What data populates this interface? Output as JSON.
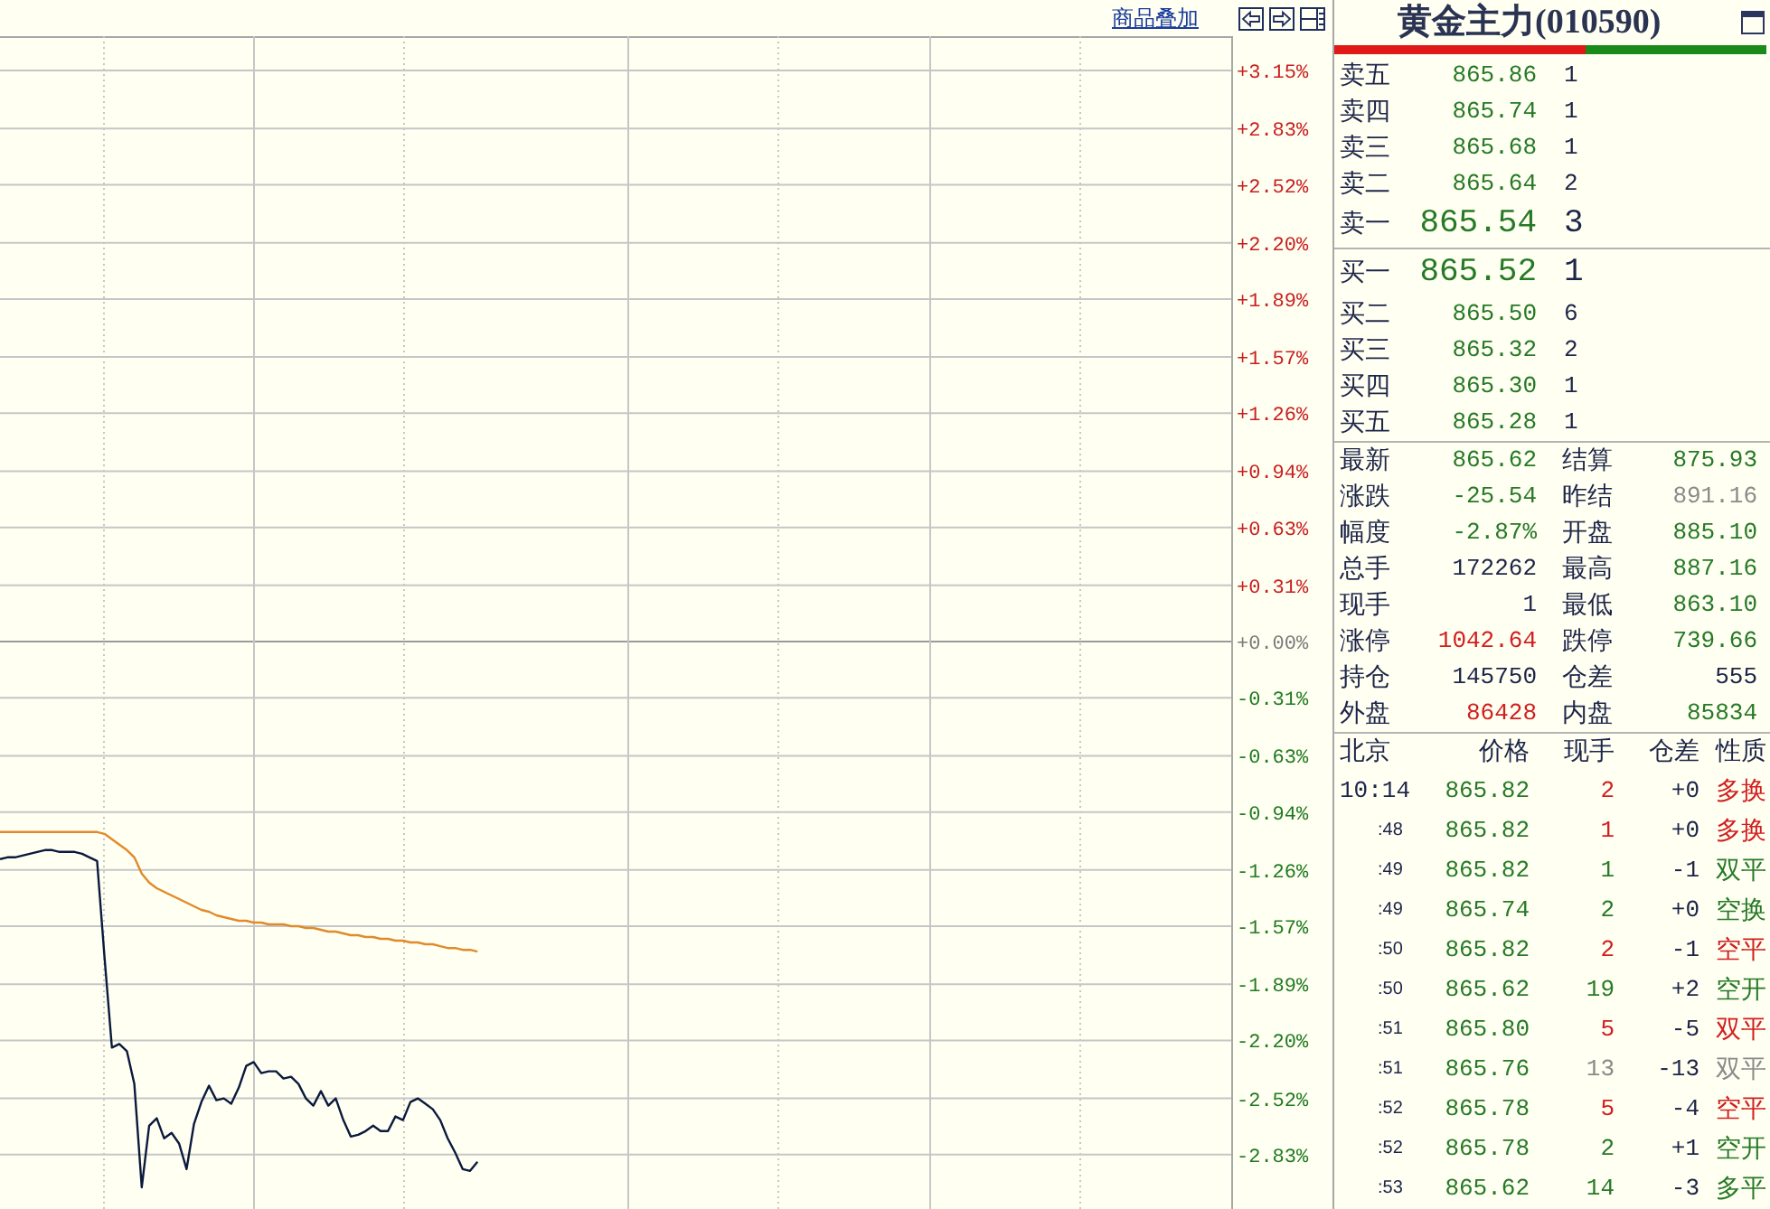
{
  "chart": {
    "overlay_link": "商品叠加",
    "chart_data": {
      "type": "line",
      "grid": true,
      "categories": [
        null,
        null,
        null,
        null,
        null,
        null,
        null,
        null,
        null,
        null,
        null,
        null,
        null,
        null,
        null,
        null,
        null,
        null,
        null,
        null,
        null,
        null,
        null,
        null,
        null,
        null,
        null,
        null,
        null,
        null,
        null,
        null,
        null,
        null,
        null,
        null,
        null,
        null,
        null,
        null,
        null,
        null,
        null,
        null,
        null,
        null,
        null,
        null,
        null,
        null,
        null,
        null,
        null,
        null,
        null,
        null,
        null,
        null,
        null,
        null,
        null,
        null,
        null,
        null,
        null,
        null,
        null,
        null,
        null,
        null,
        null,
        null,
        null,
        null,
        null,
        null,
        null,
        null,
        null,
        null,
        null,
        null,
        null,
        null,
        null,
        null,
        null,
        null,
        null,
        null,
        null,
        null,
        null,
        null,
        null,
        null,
        null,
        null,
        null,
        null,
        null,
        null,
        null,
        null,
        null,
        null,
        null,
        null,
        null,
        null,
        null,
        null,
        null,
        null,
        null,
        null,
        null,
        null,
        null,
        null,
        null,
        null,
        null,
        null,
        null,
        null,
        null,
        null,
        null,
        null,
        null,
        null,
        null,
        null,
        null,
        null,
        null,
        null,
        null,
        null,
        null,
        null,
        null,
        null,
        null,
        null,
        null,
        null,
        null,
        null,
        null,
        null,
        null,
        null,
        null,
        null,
        null,
        null,
        null,
        null,
        null,
        null,
        null,
        null,
        null,
        null
      ],
      "ylim": [
        -3.13,
        3.34
      ],
      "yticks": [
        {
          "value": 3.15,
          "label": "+3.15%"
        },
        {
          "value": 2.83,
          "label": "+2.83%"
        },
        {
          "value": 2.52,
          "label": "+2.52%"
        },
        {
          "value": 2.2,
          "label": "+2.20%"
        },
        {
          "value": 1.89,
          "label": "+1.89%"
        },
        {
          "value": 1.57,
          "label": "+1.57%"
        },
        {
          "value": 1.26,
          "label": "+1.26%"
        },
        {
          "value": 0.94,
          "label": "+0.94%"
        },
        {
          "value": 0.63,
          "label": "+0.63%"
        },
        {
          "value": 0.31,
          "label": "+0.31%"
        },
        {
          "value": 0,
          "label": "+0.00%"
        },
        {
          "value": -0.31,
          "label": "-0.31%"
        },
        {
          "value": -0.63,
          "label": "-0.63%"
        },
        {
          "value": -0.94,
          "label": "-0.94%"
        },
        {
          "value": -1.26,
          "label": "-1.26%"
        },
        {
          "value": -1.57,
          "label": "-1.57%"
        },
        {
          "value": -1.89,
          "label": "-1.89%"
        },
        {
          "value": -2.2,
          "label": "-2.20%"
        },
        {
          "value": -2.52,
          "label": "-2.52%"
        },
        {
          "value": -2.83,
          "label": "-2.83%"
        }
      ],
      "series": [
        {
          "color": "#0b1a3c",
          "values": [
            -1.2,
            -1.19,
            -1.19,
            -1.18,
            -1.17,
            -1.16,
            -1.15,
            -1.15,
            -1.16,
            -1.16,
            -1.16,
            -1.17,
            -1.19,
            -1.21,
            -1.74,
            -2.24,
            -2.22,
            -2.26,
            -2.44,
            -3.01,
            -2.67,
            -2.63,
            -2.74,
            -2.71,
            -2.77,
            -2.91,
            -2.66,
            -2.54,
            -2.45,
            -2.53,
            -2.52,
            -2.55,
            -2.46,
            -2.34,
            -2.32,
            -2.38,
            -2.37,
            -2.37,
            -2.41,
            -2.4,
            -2.44,
            -2.52,
            -2.56,
            -2.48,
            -2.56,
            -2.52,
            -2.64,
            -2.73,
            -2.72,
            -2.7,
            -2.67,
            -2.7,
            -2.7,
            -2.62,
            -2.64,
            -2.54,
            -2.52,
            -2.55,
            -2.58,
            -2.64,
            -2.74,
            -2.82,
            -2.91,
            -2.92,
            -2.87,
            null,
            null,
            null,
            null,
            null,
            null,
            null,
            null,
            null,
            null,
            null,
            null,
            null,
            null,
            null,
            null,
            null,
            null,
            null,
            null,
            null,
            null,
            null,
            null,
            null,
            null,
            null,
            null,
            null,
            null,
            null,
            null,
            null,
            null,
            null,
            null,
            null,
            null,
            null,
            null,
            null,
            null,
            null,
            null,
            null,
            null,
            null,
            null,
            null,
            null,
            null,
            null,
            null,
            null,
            null,
            null,
            null,
            null,
            null,
            null,
            null,
            null,
            null,
            null,
            null,
            null,
            null,
            null,
            null,
            null,
            null,
            null,
            null,
            null,
            null,
            null,
            null,
            null,
            null,
            null,
            null,
            null,
            null,
            null,
            null,
            null,
            null,
            null,
            null,
            null,
            null,
            null,
            null,
            null,
            null,
            null,
            null,
            null,
            null,
            null,
            null
          ]
        },
        {
          "color": "#e08a2a",
          "values": [
            -1.05,
            -1.05,
            -1.05,
            -1.05,
            -1.05,
            -1.05,
            -1.05,
            -1.05,
            -1.05,
            -1.05,
            -1.05,
            -1.05,
            -1.05,
            -1.05,
            -1.06,
            -1.09,
            -1.12,
            -1.15,
            -1.19,
            -1.28,
            -1.33,
            -1.36,
            -1.38,
            -1.4,
            -1.42,
            -1.44,
            -1.46,
            -1.48,
            -1.49,
            -1.51,
            -1.52,
            -1.53,
            -1.54,
            -1.54,
            -1.55,
            -1.55,
            -1.56,
            -1.56,
            -1.56,
            -1.57,
            -1.57,
            -1.58,
            -1.58,
            -1.59,
            -1.6,
            -1.6,
            -1.61,
            -1.62,
            -1.62,
            -1.63,
            -1.63,
            -1.64,
            -1.64,
            -1.65,
            -1.65,
            -1.66,
            -1.66,
            -1.67,
            -1.67,
            -1.68,
            -1.69,
            -1.69,
            -1.7,
            -1.7,
            -1.71,
            null,
            null,
            null,
            null,
            null,
            null,
            null,
            null,
            null,
            null,
            null,
            null,
            null,
            null,
            null,
            null,
            null,
            null,
            null,
            null,
            null,
            null,
            null,
            null,
            null,
            null,
            null,
            null,
            null,
            null,
            null,
            null,
            null,
            null,
            null,
            null,
            null,
            null,
            null,
            null,
            null,
            null,
            null,
            null,
            null,
            null,
            null,
            null,
            null,
            null,
            null,
            null,
            null,
            null,
            null,
            null,
            null,
            null,
            null,
            null,
            null,
            null,
            null,
            null,
            null,
            null,
            null,
            null,
            null,
            null,
            null,
            null,
            null,
            null,
            null,
            null,
            null,
            null,
            null,
            null,
            null,
            null,
            null,
            null,
            null,
            null,
            null,
            null,
            null,
            null,
            null,
            null,
            null,
            null,
            null,
            null,
            null,
            null,
            null,
            null,
            null
          ]
        }
      ]
    }
  },
  "quote": {
    "title": "黄金主力(010590)",
    "ratio_bar": {
      "level": 0.58
    },
    "asks": [
      {
        "label": "卖五",
        "price": "865.86",
        "volume": "1",
        "kind": "depth"
      },
      {
        "label": "卖四",
        "price": "865.74",
        "volume": "1",
        "kind": "depth"
      },
      {
        "label": "卖三",
        "price": "865.68",
        "volume": "1",
        "kind": "depth"
      },
      {
        "label": "卖二",
        "price": "865.64",
        "volume": "2",
        "kind": "depth"
      },
      {
        "label": "卖一",
        "price": "865.54",
        "volume": "3",
        "kind": "best"
      }
    ],
    "bids": [
      {
        "label": "买一",
        "price": "865.52",
        "volume": "1",
        "kind": "best"
      },
      {
        "label": "买二",
        "price": "865.50",
        "volume": "6",
        "kind": "depth"
      },
      {
        "label": "买三",
        "price": "865.32",
        "volume": "2",
        "kind": "depth"
      },
      {
        "label": "买四",
        "price": "865.30",
        "volume": "1",
        "kind": "depth"
      },
      {
        "label": "买五",
        "price": "865.28",
        "volume": "1",
        "kind": "depth"
      }
    ],
    "stats": [
      [
        {
          "label": "最新",
          "value": "865.62",
          "color": "#267a26"
        },
        {
          "label": "结算",
          "value": "875.93",
          "color": "#267a26"
        }
      ],
      [
        {
          "label": "涨跌",
          "value": "-25.54",
          "color": "#267a26"
        },
        {
          "label": "昨结",
          "value": "891.16",
          "color": "#8a8a8a"
        }
      ],
      [
        {
          "label": "幅度",
          "value": "-2.87%",
          "color": "#267a26"
        },
        {
          "label": "开盘",
          "value": "885.10",
          "color": "#267a26"
        }
      ],
      [
        {
          "label": "总手",
          "value": "172262",
          "color": "#1c2448"
        },
        {
          "label": "最高",
          "value": "887.16",
          "color": "#267a26"
        }
      ],
      [
        {
          "label": "现手",
          "value": "1",
          "color": "#1c2448"
        },
        {
          "label": "最低",
          "value": "863.10",
          "color": "#267a26"
        }
      ],
      [
        {
          "label": "涨停",
          "value": "1042.64",
          "color": "#d21e1e"
        },
        {
          "label": "跌停",
          "value": "739.66",
          "color": "#267a26"
        }
      ],
      [
        {
          "label": "持仓",
          "value": "145750",
          "color": "#1c2448"
        },
        {
          "label": "仓差",
          "value": "555",
          "color": "#1c2448"
        }
      ],
      [
        {
          "label": "外盘",
          "value": "86428",
          "color": "#d21e1e"
        },
        {
          "label": "内盘",
          "value": "85834",
          "color": "#267a26"
        }
      ]
    ]
  },
  "trades": {
    "columns": [
      "北京",
      "价格",
      "现手",
      "仓差",
      "性质"
    ],
    "rows": [
      {
        "time": "10:14",
        "kind": "full",
        "price": "865.82",
        "volume": "2",
        "change": "+0",
        "type": "多换",
        "color": "#d21e1e"
      },
      {
        "time": ":48",
        "kind": "short",
        "price": "865.82",
        "volume": "1",
        "change": "+0",
        "type": "多换",
        "color": "#d21e1e"
      },
      {
        "time": ":49",
        "kind": "short",
        "price": "865.82",
        "volume": "1",
        "change": "-1",
        "type": "双平",
        "color": "#267a26"
      },
      {
        "time": ":49",
        "kind": "short",
        "price": "865.74",
        "volume": "2",
        "change": "+0",
        "type": "空换",
        "color": "#267a26"
      },
      {
        "time": ":50",
        "kind": "short",
        "price": "865.82",
        "volume": "2",
        "change": "-1",
        "type": "空平",
        "color": "#d21e1e"
      },
      {
        "time": ":50",
        "kind": "short",
        "price": "865.62",
        "volume": "19",
        "change": "+2",
        "type": "空开",
        "color": "#267a26"
      },
      {
        "time": ":51",
        "kind": "short",
        "price": "865.80",
        "volume": "5",
        "change": "-5",
        "type": "双平",
        "color": "#d21e1e"
      },
      {
        "time": ":51",
        "kind": "short",
        "price": "865.76",
        "volume": "13",
        "change": "-13",
        "type": "双平",
        "color": "#8a8a8a"
      },
      {
        "time": ":52",
        "kind": "short",
        "price": "865.78",
        "volume": "5",
        "change": "-4",
        "type": "空平",
        "color": "#d21e1e"
      },
      {
        "time": ":52",
        "kind": "short",
        "price": "865.78",
        "volume": "2",
        "change": "+1",
        "type": "空开",
        "color": "#267a26"
      },
      {
        "time": ":53",
        "kind": "short",
        "price": "865.62",
        "volume": "14",
        "change": "-3",
        "type": "多平",
        "color": "#267a26"
      }
    ]
  }
}
